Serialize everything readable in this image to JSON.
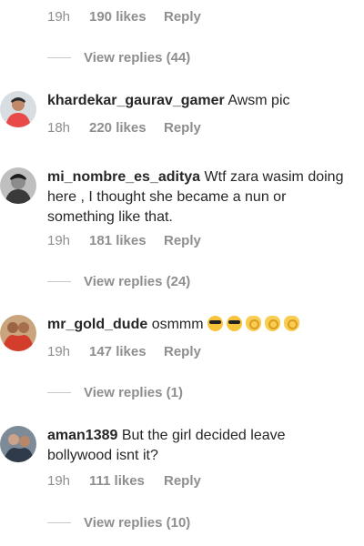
{
  "top_meta": {
    "time": "19h",
    "likes": "190 likes",
    "reply": "Reply"
  },
  "top_replies": "View replies (44)",
  "comments": [
    {
      "username": "khardekar_gaurav_gamer",
      "text": "Awsm pic",
      "time": "18h",
      "likes": "220 likes",
      "reply": "Reply"
    },
    {
      "username": "mi_nombre_es_aditya",
      "text": "Wtf zara wasim doing here , I thought she became a nun or something like that.",
      "time": "19h",
      "likes": "181 likes",
      "reply": "Reply",
      "view_replies": "View replies (24)"
    },
    {
      "username": "mr_gold_dude",
      "text": "osmmm",
      "emojis": [
        "smiling-face-with-sunglasses",
        "smiling-face-with-sunglasses",
        "ok-hand",
        "ok-hand",
        "ok-hand"
      ],
      "time": "19h",
      "likes": "147 likes",
      "reply": "Reply",
      "view_replies": "View replies (1)"
    },
    {
      "username": "aman1389",
      "text": "But the girl decided leave bollywood isnt it?",
      "time": "19h",
      "likes": "111 likes",
      "reply": "Reply",
      "view_replies": "View replies (10)"
    }
  ]
}
